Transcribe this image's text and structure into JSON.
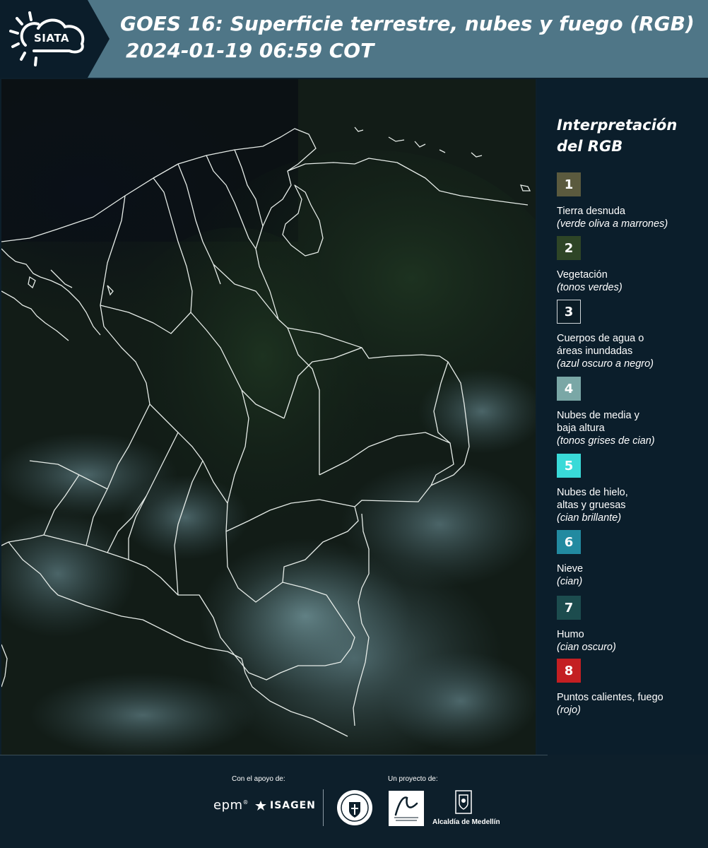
{
  "header": {
    "logo_text": "SIATA",
    "title": "GOES 16: Superficie terrestre, nubes y fuego (RGB)",
    "subtitle": "2024-01-19 06:59 COT"
  },
  "legend": {
    "title": "Interpretación del RGB",
    "items": [
      {
        "number": "1",
        "label": "Tierra desnuda",
        "desc": "(verde oliva a marrones)",
        "color": "#5b5a3e"
      },
      {
        "number": "2",
        "label": "Vegetación",
        "desc": "(tonos verdes)",
        "color": "#2e4526"
      },
      {
        "number": "3",
        "label": "Cuerpos de agua o\náreas inundadas",
        "desc": "(azul oscuro a negro)",
        "color": "#0b1c26"
      },
      {
        "number": "4",
        "label": "Nubes de media y\nbaja altura",
        "desc": "(tonos grises de cian)",
        "color": "#7aa7a6"
      },
      {
        "number": "5",
        "label": "Nubes de hielo,\naltas y gruesas",
        "desc": "(cian brillante)",
        "color": "#39dad8"
      },
      {
        "number": "6",
        "label": "Nieve",
        "desc": "(cian)",
        "color": "#228aa0"
      },
      {
        "number": "7",
        "label": "Humo",
        "desc": "(cian oscuro)",
        "color": "#1c4c4e"
      },
      {
        "number": "8",
        "label": "Puntos calientes, fuego",
        "desc": "(rojo)",
        "color": "#c41f22"
      }
    ]
  },
  "footer": {
    "support_label": "Con el apoyo de:",
    "project_label": "Un proyecto de:",
    "epm": "epm",
    "isagen": "ISAGEN",
    "alcaldia": "Alcaldía de Medellín"
  }
}
